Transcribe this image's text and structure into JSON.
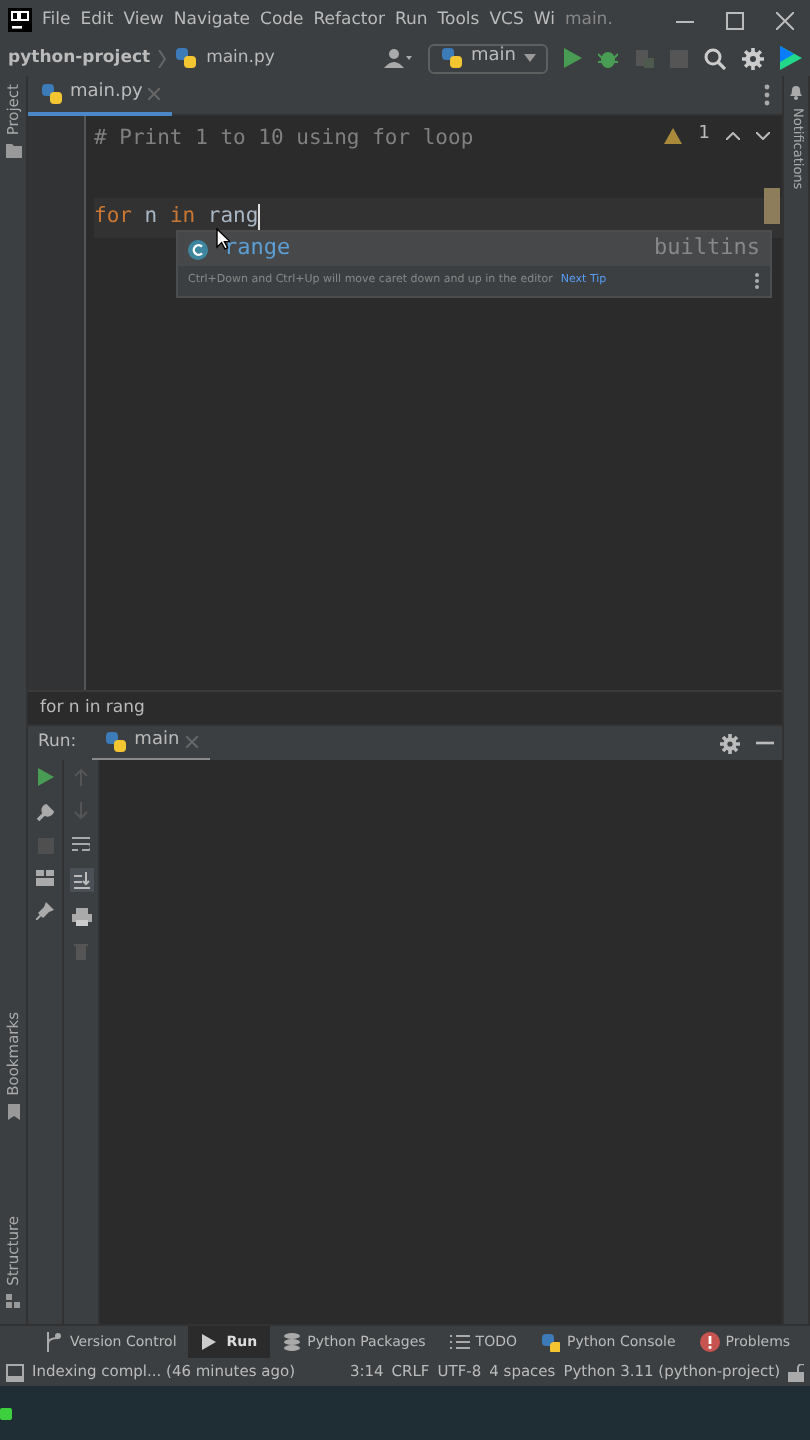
{
  "window": {
    "title": "main.",
    "menu": [
      "File",
      "Edit",
      "View",
      "Navigate",
      "Code",
      "Refactor",
      "Run",
      "Tools",
      "VCS",
      "Wi"
    ]
  },
  "navbar": {
    "breadcrumbs": [
      "python-project",
      "main.py"
    ],
    "run_config": "main"
  },
  "editor_tabs": [
    {
      "label": "main.py",
      "selected": true
    }
  ],
  "left_strip": [
    "Project",
    "Bookmarks",
    "Structure"
  ],
  "right_strip": [
    "Notifications"
  ],
  "editor": {
    "warnings": "1",
    "lines": [
      {
        "tokens": [
          {
            "text": "# Print 1 to 10 using for loop",
            "kind": "comment"
          }
        ]
      },
      {
        "tokens": [
          {
            "text": "for",
            "kind": "keyword"
          },
          {
            "text": " n ",
            "kind": "plain"
          },
          {
            "text": "in",
            "kind": "keyword"
          },
          {
            "text": " rang",
            "kind": "plain"
          }
        ],
        "current": true
      }
    ],
    "completion": {
      "item": "range",
      "source": "builtins",
      "tip": "Ctrl+Down and Ctrl+Up will move caret down and up in the editor",
      "tip_link": "Next Tip"
    },
    "breadcrumb": "for n in rang"
  },
  "run_panel": {
    "label": "Run:",
    "tabs": [
      {
        "label": "main",
        "selected": true
      }
    ]
  },
  "tool_tabs": [
    {
      "label": "Version Control",
      "selected": false
    },
    {
      "label": "Run",
      "selected": true
    },
    {
      "label": "Python Packages",
      "selected": false
    },
    {
      "label": "TODO",
      "selected": false
    },
    {
      "label": "Python Console",
      "selected": false
    },
    {
      "label": "Problems",
      "selected": false
    }
  ],
  "status_bar": {
    "message": "Indexing compl... (46 minutes ago)",
    "items": [
      "3:14",
      "CRLF",
      "UTF-8",
      "4 spaces",
      "Python 3.11 (python-project)"
    ]
  }
}
